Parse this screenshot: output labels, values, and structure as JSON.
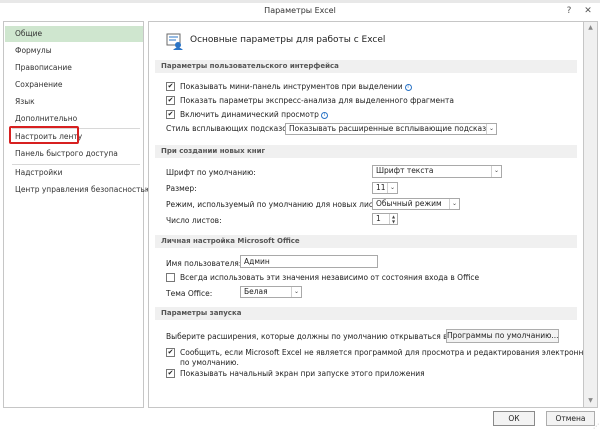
{
  "window": {
    "title": "Параметры Excel",
    "help_glyph": "?",
    "close_glyph": "✕"
  },
  "sidebar": {
    "items": [
      {
        "label": "Общие",
        "selected": true
      },
      {
        "label": "Формулы"
      },
      {
        "label": "Правописание"
      },
      {
        "label": "Сохранение"
      },
      {
        "label": "Язык"
      },
      {
        "label": "Дополнительно"
      },
      {
        "label": "Настроить ленту",
        "highlighted": true
      },
      {
        "label": "Панель быстрого доступа"
      },
      {
        "label": "Надстройки"
      },
      {
        "label": "Центр управления безопасностью"
      }
    ]
  },
  "main": {
    "header": "Основные параметры для работы с Excel",
    "ui_section": {
      "title": "Параметры пользовательского интерфейса",
      "minitoolbar": {
        "label": "Показывать мини-панель инструментов при выделении",
        "checked": true
      },
      "quick_analysis": {
        "label": "Показать параметры экспресс-анализа для выделенного фрагмента",
        "checked": true
      },
      "live_preview": {
        "label": "Включить динамический просмотр",
        "checked": true
      },
      "tooltip_style": {
        "label": "Стиль всплывающих подсказок:",
        "value": "Показывать расширенные всплывающие подсказки"
      }
    },
    "new_books_section": {
      "title": "При создании новых книг",
      "font": {
        "label": "Шрифт по умолчанию:",
        "value": "Шрифт текста"
      },
      "size": {
        "label": "Размер:",
        "value": "11"
      },
      "view": {
        "label": "Режим, используемый по умолчанию для новых листов:",
        "value": "Обычный режим"
      },
      "sheets": {
        "label": "Число листов:",
        "value": "1"
      }
    },
    "personal_section": {
      "title": "Личная настройка Microsoft Office",
      "username": {
        "label": "Имя пользователя:",
        "value": "Админ"
      },
      "always_use": {
        "label": "Всегда использовать эти значения независимо от состояния входа в Office",
        "checked": false
      },
      "theme": {
        "label": "Тема Office:",
        "value": "Белая"
      }
    },
    "startup_section": {
      "title": "Параметры запуска",
      "extensions": {
        "label": "Выберите расширения, которые должны по умолчанию открываться в Excel:",
        "button": "Программы по умолчанию..."
      },
      "notify_default": {
        "label_line1": "Сообщить, если Microsoft Excel не является программой для просмотра и редактирования электронных таблиц",
        "label_line2": "по умолчанию.",
        "checked": true
      },
      "start_screen": {
        "label": "Показывать начальный экран при запуске этого приложения",
        "checked": true
      }
    }
  },
  "footer": {
    "ok_label": "ОК",
    "cancel_label": "Отмена"
  },
  "glyphs": {
    "check": "✔",
    "drop": "⌄",
    "info": "i",
    "scroll_up": "▲",
    "scroll_down": "▼",
    "spin_up": "▲",
    "spin_down": "▼"
  },
  "colors": {
    "selected_item_bg": "#cfe6cf",
    "highlight_border": "#d72020",
    "section_bg": "#f0f0f0"
  }
}
